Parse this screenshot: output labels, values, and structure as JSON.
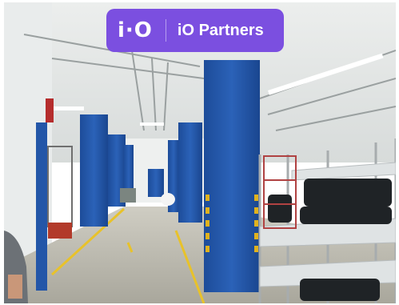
{
  "overlay": {
    "logo_mark": "i·O",
    "brand_name": "iO Partners",
    "badge_color": "#7b4fe0"
  },
  "scene": {
    "pillar_color": "#2356a8",
    "floor_color": "#b9b8ad",
    "wall_color": "#e4e7e6",
    "lane_line_color": "#e8c22a"
  }
}
